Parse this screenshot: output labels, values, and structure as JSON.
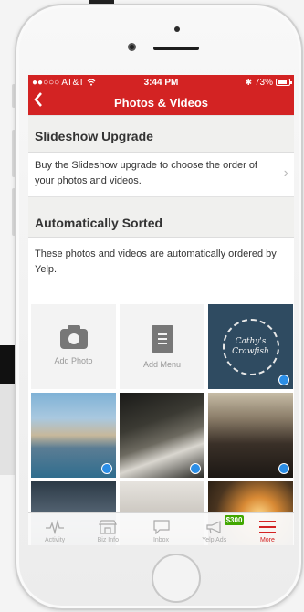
{
  "status": {
    "carrier": "●●○○○ AT&T",
    "time": "3:44 PM",
    "battery": "73%"
  },
  "nav": {
    "back_label": "<",
    "title": "Photos & Videos"
  },
  "slideshow": {
    "header": "Slideshow Upgrade",
    "text": "Buy the Slideshow upgrade to choose the order of your photos and videos.",
    "chevron": "›"
  },
  "auto": {
    "header": "Automatically Sorted",
    "text": "These photos and videos are automatically ordered by Yelp."
  },
  "grid": {
    "add_photo": "Add Photo",
    "add_menu": "Add Menu",
    "logo_text": "Cathy's Crawfish"
  },
  "tabs": [
    {
      "label": "Activity",
      "icon": "activity-icon"
    },
    {
      "label": "Biz Info",
      "icon": "storefront-icon"
    },
    {
      "label": "Inbox",
      "icon": "chat-bubble-icon"
    },
    {
      "label": "Yelp Ads",
      "icon": "megaphone-icon",
      "badge": "$300"
    },
    {
      "label": "More",
      "icon": "hamburger-icon"
    }
  ],
  "colors": {
    "brand": "#d32323",
    "badge": "#41a700",
    "dot": "#2b8ee6"
  }
}
